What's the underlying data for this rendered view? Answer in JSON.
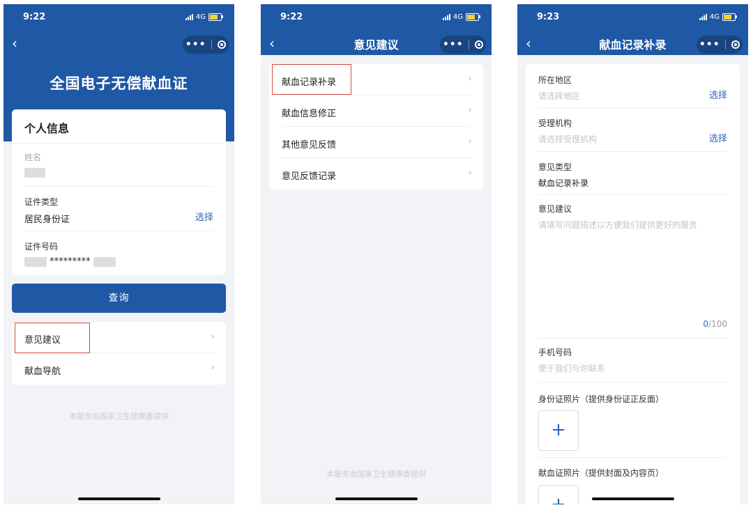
{
  "screen1": {
    "status": {
      "time": "9:22",
      "network": "4G"
    },
    "title": "全国电子无偿献血证",
    "card_title": "个人信息",
    "name": {
      "label": "姓名"
    },
    "id_type": {
      "label": "证件类型",
      "value": "居民身份证",
      "action": "选择"
    },
    "id_number": {
      "label": "证件号码",
      "masked": "*********"
    },
    "query_button": "查询",
    "menu": [
      {
        "label": "意见建议"
      },
      {
        "label": "献血导航"
      }
    ],
    "footer": "本服务由国家卫生健康委提供"
  },
  "screen2": {
    "status": {
      "time": "9:22",
      "network": "4G"
    },
    "title": "意见建议",
    "menu": [
      {
        "label": "献血记录补录"
      },
      {
        "label": "献血信息修正"
      },
      {
        "label": "其他意见反馈"
      },
      {
        "label": "意见反馈记录"
      }
    ],
    "footer": "本服务由国家卫生健康委提供"
  },
  "screen3": {
    "status": {
      "time": "9:23",
      "network": "4G"
    },
    "title": "献血记录补录",
    "region": {
      "label": "所在地区",
      "placeholder": "请选择地区",
      "action": "选择"
    },
    "org": {
      "label": "受理机构",
      "placeholder": "请选择受理机构",
      "action": "选择"
    },
    "type": {
      "label": "意见类型",
      "value": "献血记录补录"
    },
    "suggestion": {
      "label": "意见建议",
      "placeholder": "请填写问题描述以方便我们提供更好的服务",
      "count": "0",
      "max": "/100"
    },
    "phone": {
      "label": "手机号码",
      "placeholder": "便于我们与你联系"
    },
    "id_photo": {
      "label": "身份证照片（提供身份证正反面）"
    },
    "cert_photo": {
      "label": "献血证照片（提供封面及内容页）"
    },
    "upload_symbol": "+"
  },
  "icons": {
    "back": "‹",
    "chevron": "›",
    "more": "•••"
  },
  "colors": {
    "primary": "#1f58a5",
    "link": "#2f66b5",
    "highlight": "#d9463a"
  }
}
